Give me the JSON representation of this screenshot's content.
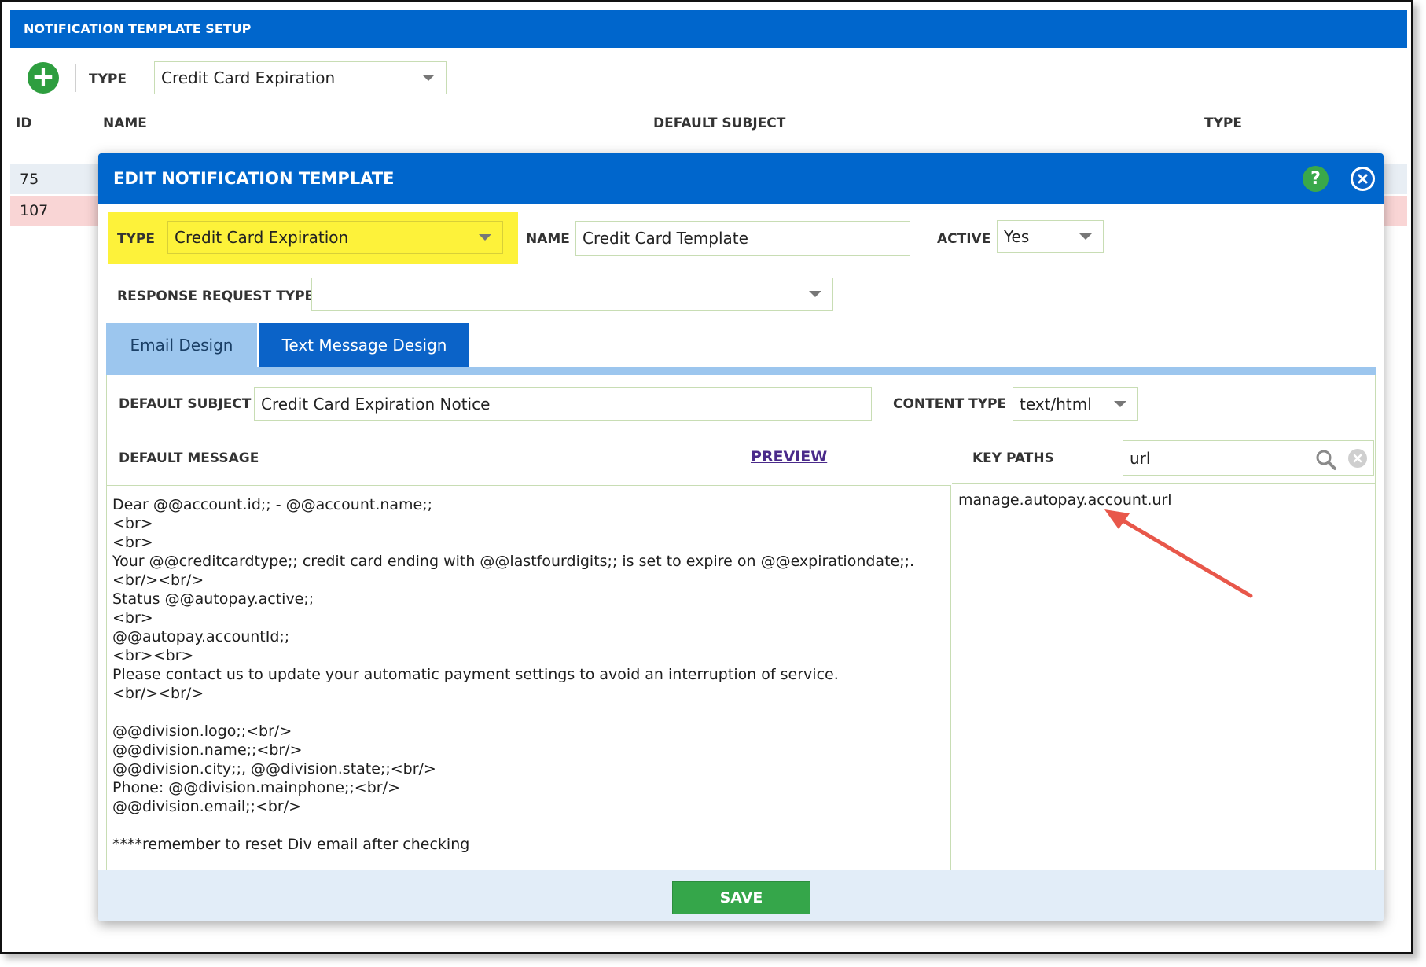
{
  "page": {
    "title": "NOTIFICATION TEMPLATE SETUP",
    "type_label": "TYPE",
    "type_value": "Credit Card Expiration",
    "columns": [
      "ID",
      "NAME",
      "DEFAULT SUBJECT",
      "TYPE"
    ],
    "rows": [
      "75",
      "107"
    ]
  },
  "modal": {
    "title": "EDIT NOTIFICATION TEMPLATE",
    "help_label": "?",
    "type_label": "TYPE",
    "type_value": "Credit Card Expiration",
    "name_label": "NAME",
    "name_value": "Credit Card Template",
    "active_label": "ACTIVE",
    "active_value": "Yes",
    "response_request_type_label": "RESPONSE REQUEST TYPE",
    "response_request_type_value": "",
    "tabs": [
      {
        "label": "Email Design",
        "active": true
      },
      {
        "label": "Text Message Design",
        "active": false
      }
    ],
    "default_subject_label": "DEFAULT SUBJECT",
    "default_subject_value": "Credit Card Expiration Notice",
    "content_type_label": "CONTENT TYPE",
    "content_type_value": "text/html",
    "default_message_label": "DEFAULT MESSAGE",
    "preview_link": "PREVIEW",
    "key_paths_label": "KEY PATHS",
    "key_paths_search": "url",
    "key_paths_results": [
      "manage.autopay.account.url"
    ],
    "message_lines": [
      "Dear @@account.id;; - @@account.name;;",
      "<br>",
      "<br>",
      "Your @@creditcardtype;; credit card ending with @@lastfourdigits;; is set to expire on @@expirationdate;;.",
      "<br/><br/>",
      "Status @@autopay.active;;",
      "<br>",
      "@@autopay.accountId;;",
      "<br><br>",
      "Please contact us to update your automatic payment settings to avoid an interruption of service.",
      "<br/><br/>",
      "",
      "@@division.logo;;<br/>",
      "@@division.name;;<br/>",
      "@@division.city;;, @@division.state;;<br/>",
      "Phone: @@division.mainphone;;<br/>",
      "@@division.email;;<br/>",
      "",
      "****remember to reset Div email after checking"
    ],
    "save_label": "SAVE"
  },
  "colors": {
    "header_blue": "#0066cc",
    "highlight_yellow": "#fdf23a",
    "save_green": "#35a64a",
    "arrow_red": "#e8574a"
  }
}
